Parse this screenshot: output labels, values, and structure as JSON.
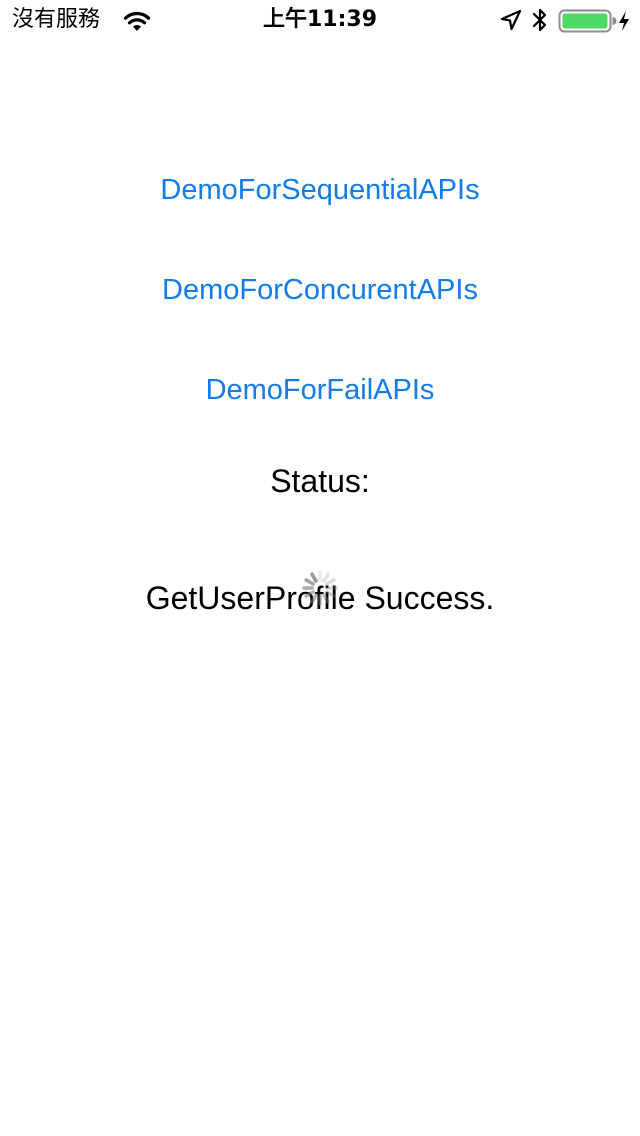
{
  "status_bar": {
    "carrier": "沒有服務",
    "time": "上午11:39",
    "battery_color": "#4cd964",
    "icons": [
      "wifi-icon",
      "location-icon",
      "bluetooth-icon",
      "battery-icon",
      "charging-icon"
    ]
  },
  "main": {
    "buttons": [
      {
        "label": "DemoForSequentialAPIs"
      },
      {
        "label": "DemoForConcurentAPIs"
      },
      {
        "label": "DemoForFailAPIs"
      }
    ],
    "status_label": "Status:",
    "status_message": "GetUserProfile Success.",
    "activity_indicator": "spinner-icon",
    "link_color": "#127cea"
  }
}
